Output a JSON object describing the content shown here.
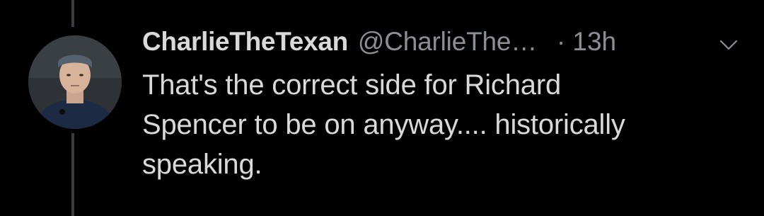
{
  "tweet": {
    "author": {
      "display_name": "CharlieTheTexan",
      "handle": "@CharlieThe…",
      "avatar_icon": "user-avatar-photo"
    },
    "separator": "·",
    "timestamp": "13h",
    "menu_icon": "chevron-down-icon",
    "text_lines": [
      "That's the correct side for Richard",
      "Spencer to be on anyway.... historically",
      "speaking."
    ]
  },
  "colors": {
    "background": "#000000",
    "primary_text": "#d9d9d9",
    "secondary_text": "#8b8f93",
    "thread_line": "#3a3d40"
  }
}
